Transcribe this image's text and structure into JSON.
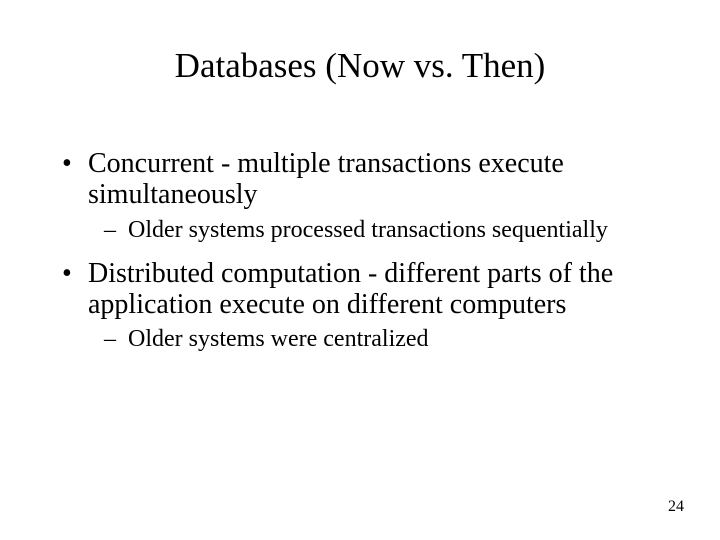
{
  "title": "Databases (Now vs. Then)",
  "bullets": [
    {
      "text": "Concurrent - multiple transactions execute simultaneously",
      "sub": [
        "Older systems processed transactions sequentially"
      ]
    },
    {
      "text": "Distributed computation - different parts of the application execute on different computers",
      "sub": [
        "Older systems were centralized"
      ]
    }
  ],
  "page_number": "24"
}
